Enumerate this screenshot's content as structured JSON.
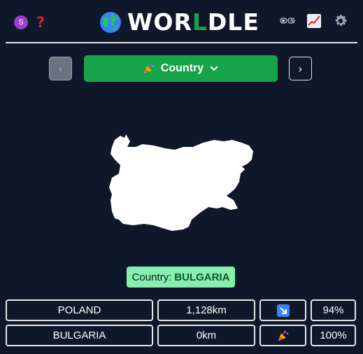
{
  "header": {
    "avatar_letter": "S",
    "help_icon": "question-mark",
    "title_prefix": "WOR",
    "title_highlight": "L",
    "title_suffix": "DLE",
    "globe_icon": "globe-icon",
    "icons": [
      "gamepad-icon",
      "chart-icon",
      "gear-icon"
    ]
  },
  "nav": {
    "prev_label": "‹",
    "next_label": "›",
    "round_label": "Country",
    "round_icon": "party-popper-icon"
  },
  "answer": {
    "prefix": "Country:",
    "country": "BULGARIA"
  },
  "guesses": [
    {
      "name": "POLAND",
      "distance": "1,128km",
      "direction": "south-east-arrow",
      "percent": "94%"
    },
    {
      "name": "BULGARIA",
      "distance": "0km",
      "direction": "party-popper",
      "percent": "100%"
    }
  ],
  "colors": {
    "background": "#0f172a",
    "accent": "#16a34a",
    "answer_bg": "#86efac",
    "direction_bg": "#3b82f6"
  }
}
